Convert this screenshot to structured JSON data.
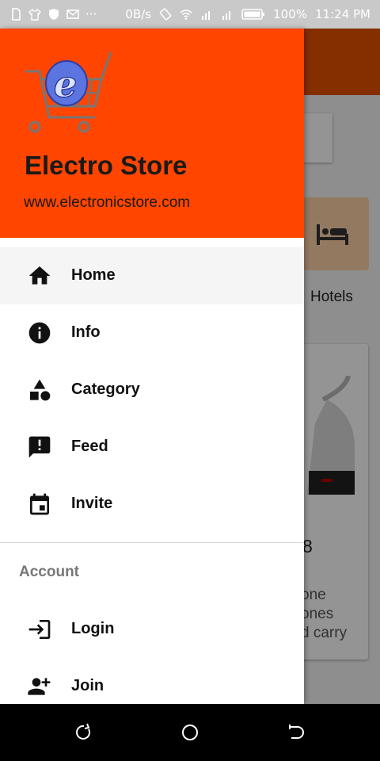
{
  "status_bar": {
    "network_speed": "0B/s",
    "battery": "100%",
    "time": "11:24 PM"
  },
  "background_page": {
    "category_label": "Hotels",
    "price_fragment": "8",
    "description_lines": [
      "one",
      "ones",
      "d carry"
    ]
  },
  "drawer": {
    "header": {
      "store_name": "Electro Store",
      "store_url": "www.electronicstore.com",
      "color": "#ff4500"
    },
    "menu": [
      {
        "label": "Home",
        "icon": "home-icon",
        "active": true
      },
      {
        "label": "Info",
        "icon": "info-icon",
        "active": false
      },
      {
        "label": "Category",
        "icon": "category-icon",
        "active": false
      },
      {
        "label": "Feed",
        "icon": "feed-icon",
        "active": false
      },
      {
        "label": "Invite",
        "icon": "calendar-icon",
        "active": false
      }
    ],
    "account_section": {
      "title": "Account",
      "items": [
        {
          "label": "Login",
          "icon": "login-icon"
        },
        {
          "label": "Join",
          "icon": "add-person-icon"
        }
      ]
    }
  }
}
